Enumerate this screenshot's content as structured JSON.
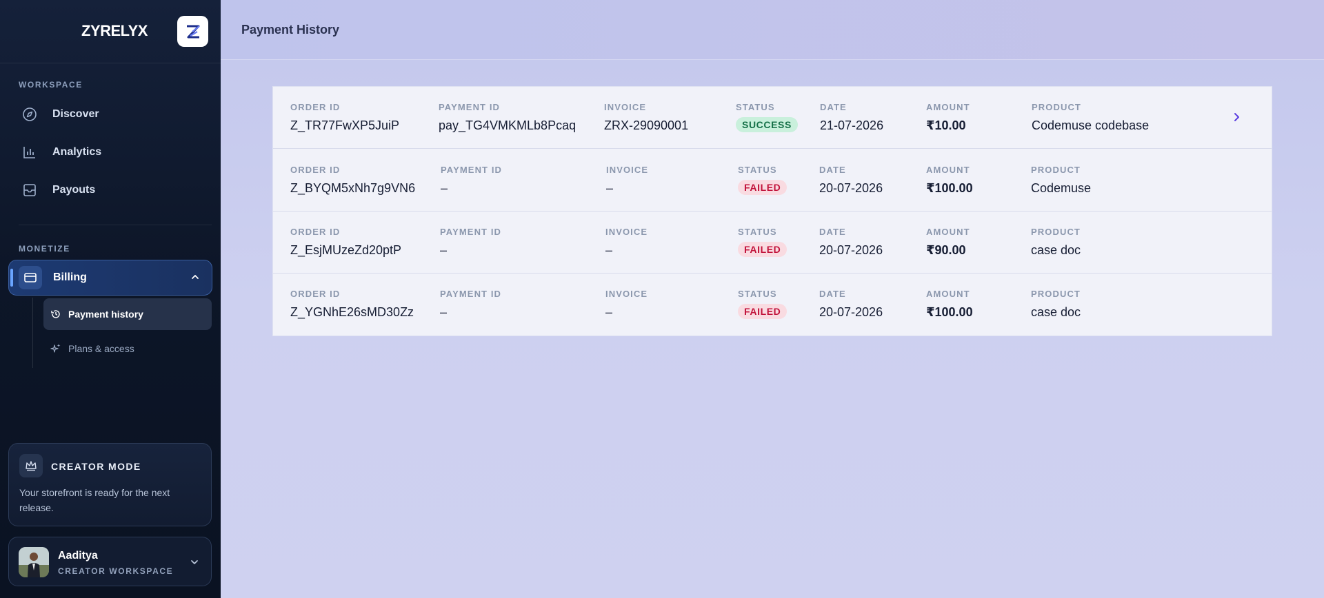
{
  "brand": {
    "name": "ZYRELYX"
  },
  "sidebar": {
    "workspace_label": "WORKSPACE",
    "workspace_items": [
      {
        "label": "Discover",
        "icon": "compass-icon"
      },
      {
        "label": "Analytics",
        "icon": "bar-chart-icon"
      },
      {
        "label": "Payouts",
        "icon": "inbox-icon"
      }
    ],
    "monetize_label": "MONETIZE",
    "billing": {
      "label": "Billing",
      "icon": "credit-card-icon",
      "expanded": true,
      "children": [
        {
          "label": "Payment history",
          "icon": "history-icon",
          "active": true
        },
        {
          "label": "Plans & access",
          "icon": "sparkles-icon",
          "active": false
        }
      ]
    },
    "creator_card": {
      "title": "CREATOR MODE",
      "text": "Your storefront is ready for the next release."
    },
    "profile": {
      "name": "Aaditya",
      "role": "CREATOR WORKSPACE"
    }
  },
  "header": {
    "title": "Payment History"
  },
  "table": {
    "headers": {
      "order_id": "ORDER ID",
      "payment_id": "PAYMENT ID",
      "invoice": "INVOICE",
      "status": "STATUS",
      "date": "DATE",
      "amount": "AMOUNT",
      "product": "PRODUCT"
    },
    "rows": [
      {
        "order_id": "Z_TR77FwXP5JuiP",
        "payment_id": "pay_TG4VMKMLb8Pcaq",
        "invoice": "ZRX-29090001",
        "status": "SUCCESS",
        "date": "21-07-2026",
        "amount": "₹10.00",
        "product": "Codemuse codebase"
      },
      {
        "order_id": "Z_BYQM5xNh7g9VN6",
        "payment_id": "–",
        "invoice": "–",
        "status": "FAILED",
        "date": "20-07-2026",
        "amount": "₹100.00",
        "product": "Codemuse"
      },
      {
        "order_id": "Z_EsjMUzeZd20ptP",
        "payment_id": "–",
        "invoice": "–",
        "status": "FAILED",
        "date": "20-07-2026",
        "amount": "₹90.00",
        "product": "case doc"
      },
      {
        "order_id": "Z_YGNhE26sMD30Zz",
        "payment_id": "–",
        "invoice": "–",
        "status": "FAILED",
        "date": "20-07-2026",
        "amount": "₹100.00",
        "product": "case doc"
      }
    ]
  },
  "colors": {
    "sidebar_bg": "#0d1628",
    "accent": "#6aa5ff",
    "success": "#157048",
    "failed": "#c1123a",
    "chevron": "#5b3ee0"
  }
}
